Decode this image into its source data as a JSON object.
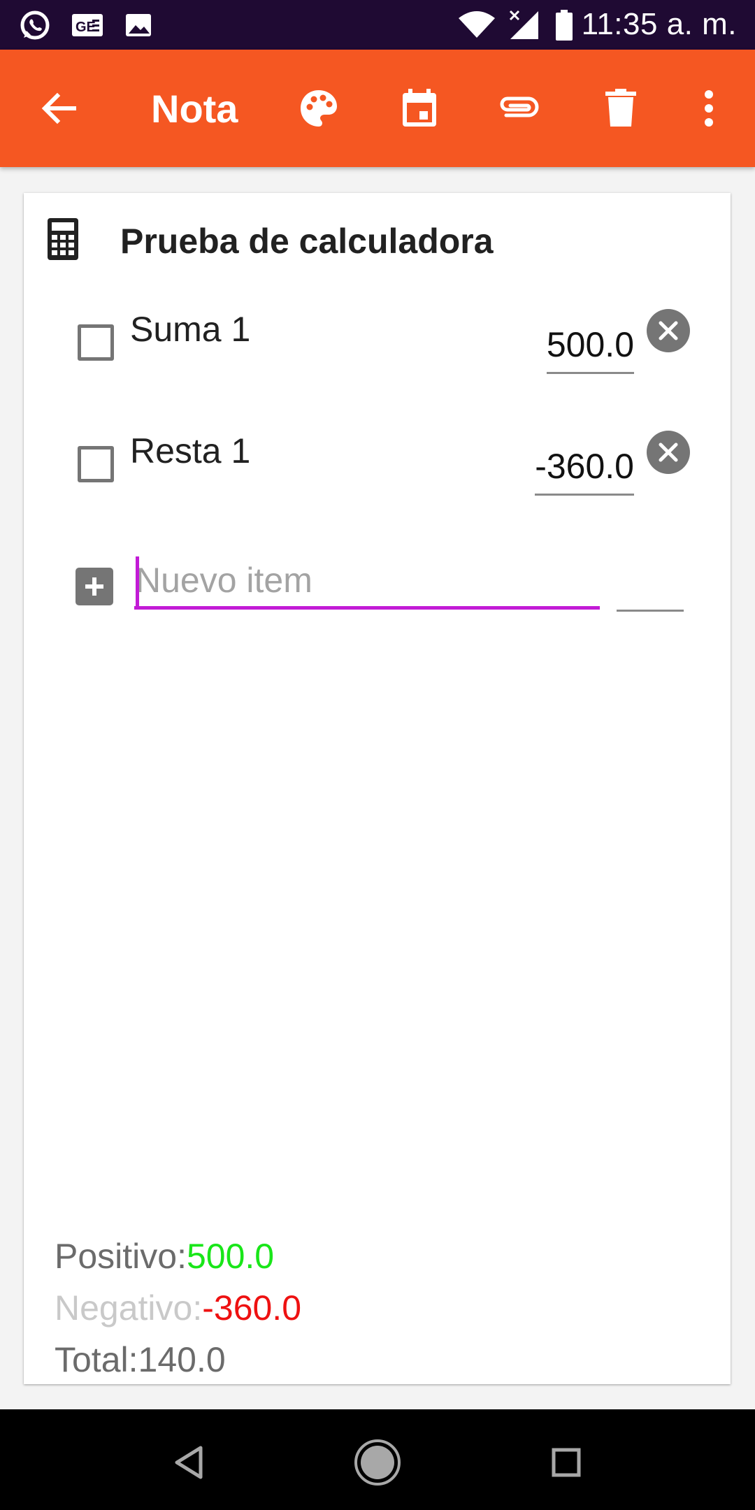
{
  "status_bar": {
    "time": "11:35 a. m.",
    "left_icons": [
      "whatsapp-icon",
      "news-icon",
      "image-icon"
    ],
    "right_icons": [
      "wifi-icon",
      "signal-icon",
      "battery-icon"
    ]
  },
  "app_bar": {
    "title": "Nota",
    "back_icon": "arrow-back-icon",
    "actions": [
      "palette-icon",
      "calendar-icon",
      "attach-icon",
      "delete-icon",
      "more-vert-icon"
    ]
  },
  "note": {
    "title": "Prueba de calculadora",
    "title_icon": "calculator-icon",
    "items": [
      {
        "label": "Suma 1",
        "value": "500.0",
        "checked": false
      },
      {
        "label": "Resta 1",
        "value": "-360.0",
        "checked": false
      }
    ],
    "new_item": {
      "placeholder": "Nuevo item",
      "value": ""
    }
  },
  "summary": {
    "positive_label": "Positivo:",
    "positive_value": "500.0",
    "negative_label": "Negativo:",
    "negative_value": "-360.0",
    "total_label": "Total:",
    "total_value": "140.0"
  },
  "colors": {
    "status_bar": "#1f0a33",
    "app_bar": "#f55722",
    "input_accent": "#c21bd6",
    "positive": "#19e619",
    "negative": "#ee1111"
  },
  "nav_bar": {
    "buttons": [
      "back-triangle-icon",
      "home-circle-icon",
      "recents-square-icon"
    ]
  }
}
